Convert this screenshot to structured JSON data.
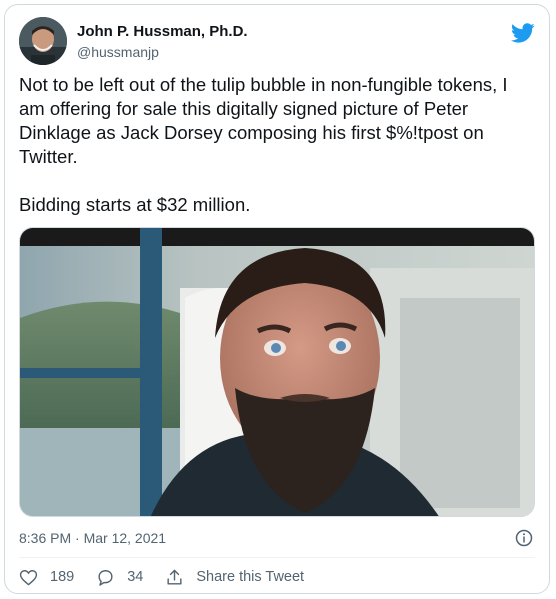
{
  "author": {
    "display_name": "John P. Hussman, Ph.D.",
    "handle": "@hussmanjp"
  },
  "tweet": {
    "text": "Not to be left out of the tulip bubble in non-fungible tokens, I am offering for sale this digitally signed picture of Peter Dinklage as Jack Dorsey composing his first $%!tpost on Twitter.\n\nBidding starts at $32 million.",
    "timestamp": "8:36 PM · Mar 12, 2021"
  },
  "actions": {
    "likes": "189",
    "replies": "34",
    "share_label": "Share this Tweet"
  },
  "colors": {
    "twitter_blue": "#1d9bf0",
    "text_primary": "#0f1419",
    "text_secondary": "#536471",
    "border": "#cfd9de"
  },
  "icons": {
    "logo": "twitter-bird-icon",
    "info": "info-icon",
    "like": "heart-icon",
    "reply": "reply-bubble-icon",
    "share": "share-icon"
  }
}
